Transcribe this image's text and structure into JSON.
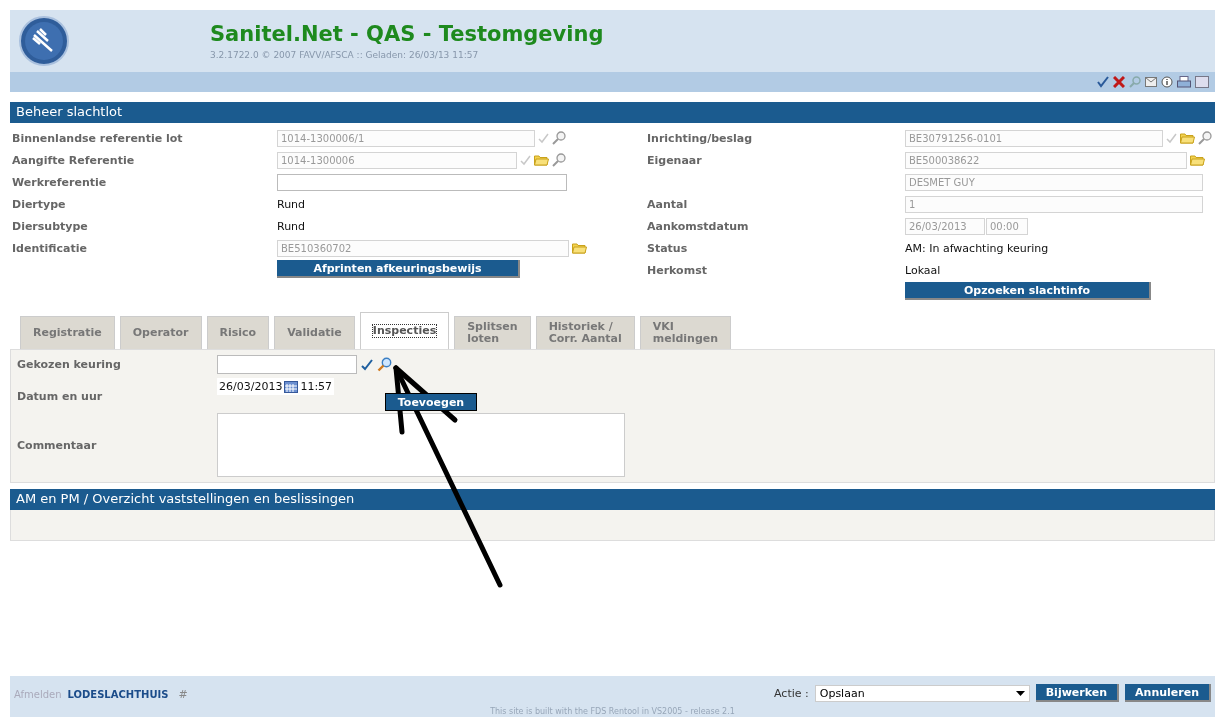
{
  "header": {
    "title": "Sanitel.Net - QAS - Testomgeving",
    "version": "3.2.1722.0 © 2007 FAVV/AFSCA :: Geladen: 26/03/13 11:57"
  },
  "section": {
    "title": "Beheer slachtlot"
  },
  "left_fields": [
    {
      "label": "Binnenlandse referentie lot",
      "kind": "lookup",
      "value": "1014-1300006/1",
      "disabled": true
    },
    {
      "label": "Aangifte Referentie",
      "kind": "lookup_folder",
      "value": "1014-1300006",
      "disabled": true
    },
    {
      "label": "Werkreferentie",
      "kind": "input"
    },
    {
      "label": "Diertype",
      "kind": "text",
      "value": "Rund"
    },
    {
      "label": "Diersubtype",
      "kind": "text",
      "value": "Rund"
    },
    {
      "label": "Identificatie",
      "kind": "folder",
      "value": "BE510360702",
      "disabled": true
    },
    {
      "kind": "button",
      "value": "Afprinten afkeuringsbewijs"
    }
  ],
  "right_fields": [
    {
      "label": "Inrichting/beslag",
      "kind": "lookup_folder",
      "value": "BE30791256-0101",
      "disabled": true
    },
    {
      "label": "Eigenaar",
      "kind": "folder",
      "value": "BE500038622",
      "disabled": true
    },
    {
      "kind": "input",
      "value": "DESMET GUY",
      "disabled": true
    },
    {
      "label": "Aantal",
      "kind": "input",
      "value": "1",
      "disabled": true
    },
    {
      "label": "Aankomstdatum",
      "kind": "datetime",
      "value": "26/03/2013",
      "time": "00:00"
    },
    {
      "label": "Status",
      "kind": "text",
      "value": "AM: In afwachting keuring"
    },
    {
      "label": "Herkomst",
      "kind": "text",
      "value": "Lokaal"
    },
    {
      "kind": "button",
      "value": "Opzoeken slachtinfo"
    }
  ],
  "tabs": [
    {
      "label": "Registratie",
      "selected": false
    },
    {
      "label": "Operator",
      "selected": false
    },
    {
      "label": "Risico",
      "selected": false
    },
    {
      "label": "Validatie",
      "selected": false
    },
    {
      "label": "Inspecties",
      "selected": true
    },
    {
      "label": "Splitsen\nloten",
      "selected": false
    },
    {
      "label": "Historiek /\nCorr. Aantal",
      "selected": false
    },
    {
      "label": "VKI\nmeldingen",
      "selected": false
    }
  ],
  "inspection": {
    "keuring_label": "Gekozen keuring",
    "datum_label": "Datum en uur",
    "date": "26/03/2013",
    "time": "11:57",
    "add_button": "Toevoegen",
    "comment_label": "Commentaar"
  },
  "overview": {
    "title": "AM en PM / Overzicht vaststellingen en beslissingen"
  },
  "footer": {
    "logout": "Afmelden",
    "user": "LODESLACHTHUIS",
    "hash": "#",
    "action_label": "Actie :",
    "action_value": "Opslaan",
    "update_button": "Bijwerken",
    "cancel_button": "Annuleren",
    "credit": "This site is built with the FDS Rentool in VS2005 - release 2.1"
  }
}
